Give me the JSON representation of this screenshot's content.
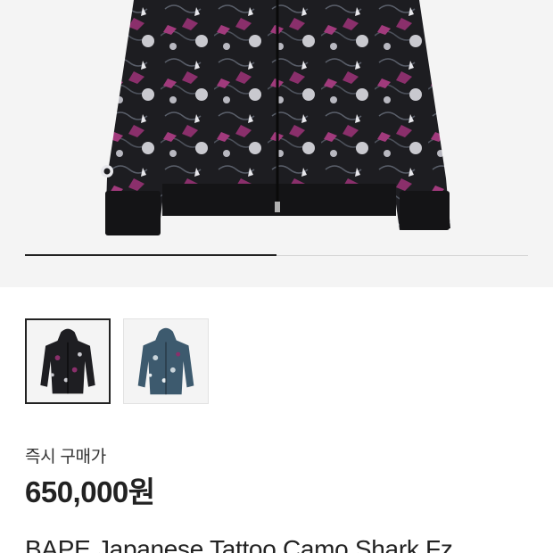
{
  "gallery": {
    "progress_fraction": 0.5,
    "thumbnails": [
      {
        "name": "black",
        "selected": true,
        "color": "#1e1e22",
        "accent": "#8a2f6b"
      },
      {
        "name": "blue",
        "selected": false,
        "color": "#3d5a6e",
        "accent": "#c9d4da"
      }
    ]
  },
  "price": {
    "label": "즉시 구매가",
    "value": "650,000원"
  },
  "product": {
    "title": "BAPE Japanese Tattoo Camo Shark Fz"
  }
}
